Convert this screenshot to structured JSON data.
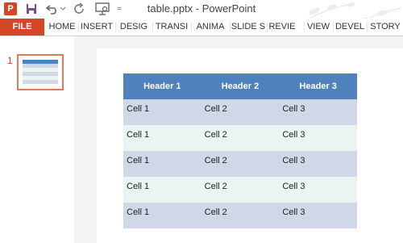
{
  "app": {
    "title": "table.pptx - PowerPoint",
    "logo_letter": "P",
    "accent": "#d24726"
  },
  "quick_access": {
    "icons": [
      "save-icon",
      "undo-icon",
      "redo-icon",
      "slideshow-icon"
    ],
    "more": "="
  },
  "ribbon": {
    "tabs": [
      "FILE",
      "HOME",
      "INSERT",
      "DESIG",
      "TRANSI",
      "ANIMA",
      "SLIDE S",
      "REVIE",
      "VIEW",
      "DEVEL",
      "STORY"
    ]
  },
  "thumbnails": {
    "slide_number": "1"
  },
  "table": {
    "header_color": "#4f81bd",
    "band_colors": [
      "#d0d8e8",
      "#e9f4f3"
    ],
    "headers": [
      "Header 1",
      "Header 2",
      "Header 3"
    ],
    "rows": [
      [
        "Cell 1",
        "Cell 2",
        "Cell 3"
      ],
      [
        "Cell 1",
        "Cell 2",
        "Cell 3"
      ],
      [
        "Cell 1",
        "Cell 2",
        "Cell 3"
      ],
      [
        "Cell 1",
        "Cell 2",
        "Cell 3"
      ],
      [
        "Cell 1",
        "Cell 2",
        "Cell 3"
      ]
    ]
  }
}
